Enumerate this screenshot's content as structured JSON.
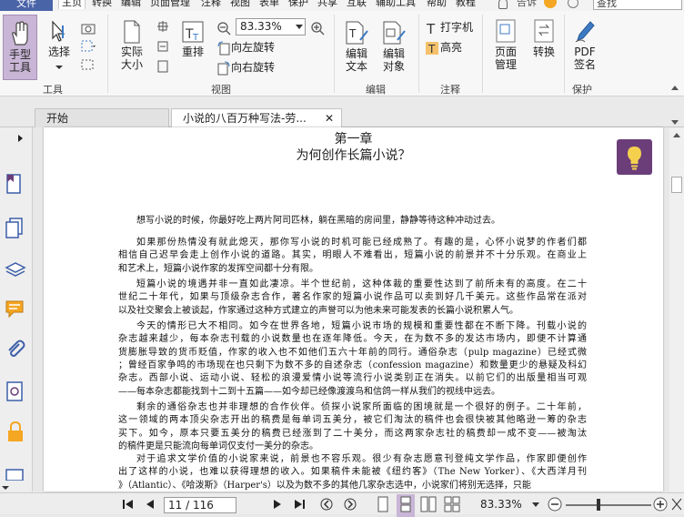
{
  "menu": {
    "file": "文件",
    "tabs": [
      "主页",
      "转换",
      "编辑",
      "页面管理",
      "注释",
      "视图",
      "表单",
      "保护",
      "共享",
      "互联",
      "辅助工具",
      "帮助",
      "教程"
    ],
    "tell": "告诉",
    "search_placeholder": "查找"
  },
  "ribbon": {
    "hand_tool": "手型工具",
    "select": "选择",
    "actual_size": "实际大小",
    "reflow": "重排",
    "zoom_value": "83.33%",
    "rotate_left": "向左旋转",
    "rotate_right": "向右旋转",
    "edit_text": "编辑文本",
    "edit_object": "编辑对象",
    "typewriter": "打字机",
    "highlight": "高亮",
    "page_manage": "页面管理",
    "convert": "转换",
    "pdf_sign": "PDF签名",
    "groups": {
      "tools": "工具",
      "view": "视图",
      "edit": "编辑",
      "comment": "注释",
      "protect": "保护"
    }
  },
  "doctabs": {
    "start": "开始",
    "doc": "小说的八百万种写法-劳..."
  },
  "document": {
    "chapter": "第一章",
    "title": "为何创作长篇小说？",
    "paragraphs": [
      {
        "lines": [
          "想写小说的时候，你最好吃上两片阿司匹林，躺在黑暗的房间里，静静等待这种冲动过去。"
        ]
      },
      {
        "lines": [
          "如果那份热情没有就此熄灭，那你写小说的时机可能已经成熟了。有趣的是，心怀小说梦的作者们都",
          "相信自己迟早会走上创作小说的道路。其实，明眼人不难看出，短篇小说的前景并不十分乐观。在商业上",
          "和艺术上，短篇小说作家的发挥空间都十分有限。"
        ]
      },
      {
        "lines": [
          "短篇小说的境遇并非一直如此凄凉。半个世纪前，这种体裁的重要性达到了前所未有的高度。在二十",
          "世纪二十年代，如果与顶级杂志合作，著名作家的短篇小说作品可以卖到好几千美元。这些作品常在派对",
          "以及社交聚会上被谈起，作家通过这种方式建立的声誉可以为他未来可能发表的长篇小说积累人气。"
        ]
      },
      {
        "lines": [
          "今天的情形已大不相同。如今在世界各地，短篇小说市场的规模和重要性都在不断下降。刊载小说的",
          "杂志越来越少，每本杂志刊载的小说数量也在逐年降低。今天，在为数不多的发达市场内，即便不计算通",
          "货膨胀导致的货币贬值，作家的收入也不如他们五六十年前的同行。通俗杂志（pulp magazine）已经式微",
          "；曾经百家争鸣的市场现在也只剩下为数不多的自述杂志（confession magazine）和数量更少的悬疑及科幻",
          "杂志。西部小说、运动小说、轻松的浪漫爱情小说等流行小说类别正在消失。以前它们的出版量相当可观",
          "——每本杂志都能找到十二到十五篇——如今却已经像渡渡鸟和信鸽一样从我们的视线中远去。"
        ]
      },
      {
        "lines": [
          "剩余的通俗杂志也并非理想的合作伙伴。侦探小说家所面临的困境就是一个很好的例子。二十年前，",
          "这一领域的两本顶尖杂志开出的稿费是每单词五美分，被它们淘汰的稿件也会很快被其他略逊一筹的杂志",
          "买下。如今，原本只要五美分的稿费已经涨到了二十美分，而这两家杂志社的稿费却一成不变——被淘汰",
          "的稿件更是只能流向每单词仅支付一美分的杂志。"
        ]
      },
      {
        "lines": [
          "对于追求文学价值的小说家来说，前景也不容乐观。很少有杂志愿意刊登纯文学作品，作家即便创作",
          "出了这样的小说，也难以获得理想的收入。如果稿件未能被《纽约客》（The New Yorker）、《大西洋月刊",
          "》（Atlantic）、《哈泼斯》（Harper's）以及为数不多的其他几家杂志选中，小说家们将别无选择，只能"
        ]
      }
    ]
  },
  "status": {
    "page_value": "11 / 116",
    "zoom": "83.33%"
  },
  "colors": {
    "file_bg": "#4a64a8",
    "bulb_bg": "#6b3e7a",
    "hand_bg": "#c9b6d6"
  }
}
